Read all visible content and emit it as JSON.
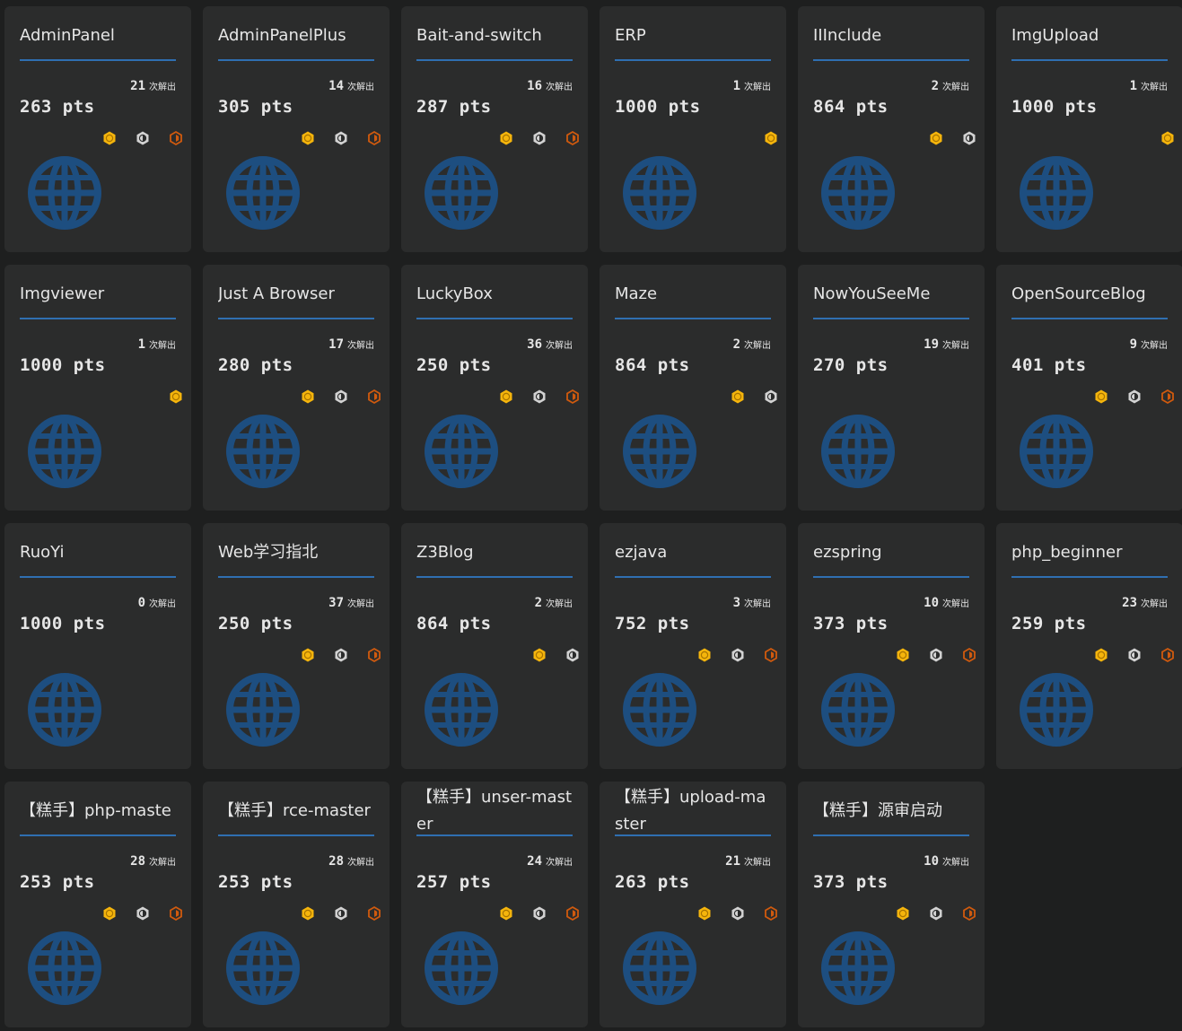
{
  "ui": {
    "solves_label": "次解出",
    "colors": {
      "card_bg": "#2b2c2c",
      "page_bg": "#1e1f1f",
      "rule": "#2f6fb1",
      "globe": "#1d4e80",
      "first_blood": "#f5b50c",
      "second_blood": "#d2d2d2",
      "third_blood": "#d05a0e"
    },
    "icons": {
      "category": "globe-icon",
      "first": "gold-medal-icon",
      "second": "silver-medal-icon",
      "third": "bronze-medal-icon"
    }
  },
  "challenges": [
    {
      "title": "AdminPanel",
      "solves": "21",
      "points": "263 pts",
      "medals": 3
    },
    {
      "title": "AdminPanelPlus",
      "solves": "14",
      "points": "305 pts",
      "medals": 3
    },
    {
      "title": "Bait-and-switch",
      "solves": "16",
      "points": "287 pts",
      "medals": 3
    },
    {
      "title": "ERP",
      "solves": "1",
      "points": "1000 pts",
      "medals": 1
    },
    {
      "title": "IIInclude",
      "solves": "2",
      "points": "864 pts",
      "medals": 2
    },
    {
      "title": "ImgUpload",
      "solves": "1",
      "points": "1000 pts",
      "medals": 1
    },
    {
      "title": "Imgviewer",
      "solves": "1",
      "points": "1000 pts",
      "medals": 1
    },
    {
      "title": "Just A Browser",
      "solves": "17",
      "points": "280 pts",
      "medals": 3
    },
    {
      "title": "LuckyBox",
      "solves": "36",
      "points": "250 pts",
      "medals": 3
    },
    {
      "title": "Maze",
      "solves": "2",
      "points": "864 pts",
      "medals": 2
    },
    {
      "title": "NowYouSeeMe",
      "solves": "19",
      "points": "270 pts",
      "medals": 0
    },
    {
      "title": "OpenSourceBlog",
      "solves": "9",
      "points": "401 pts",
      "medals": 3
    },
    {
      "title": "RuoYi",
      "solves": "0",
      "points": "1000 pts",
      "medals": 0
    },
    {
      "title": "Web学习指北",
      "solves": "37",
      "points": "250 pts",
      "medals": 3
    },
    {
      "title": "Z3Blog",
      "solves": "2",
      "points": "864 pts",
      "medals": 2
    },
    {
      "title": "ezjava",
      "solves": "3",
      "points": "752 pts",
      "medals": 3
    },
    {
      "title": "ezspring",
      "solves": "10",
      "points": "373 pts",
      "medals": 3
    },
    {
      "title": "php_beginner",
      "solves": "23",
      "points": "259 pts",
      "medals": 3
    },
    {
      "title": "【糕手】php-master",
      "solves": "28",
      "points": "253 pts",
      "medals": 3
    },
    {
      "title": "【糕手】rce-master",
      "solves": "28",
      "points": "253 pts",
      "medals": 3
    },
    {
      "title": "【糕手】unser-master",
      "solves": "24",
      "points": "257 pts",
      "medals": 3
    },
    {
      "title": "【糕手】upload-master",
      "solves": "21",
      "points": "263 pts",
      "medals": 3
    },
    {
      "title": "【糕手】源审启动",
      "solves": "10",
      "points": "373 pts",
      "medals": 3
    }
  ]
}
